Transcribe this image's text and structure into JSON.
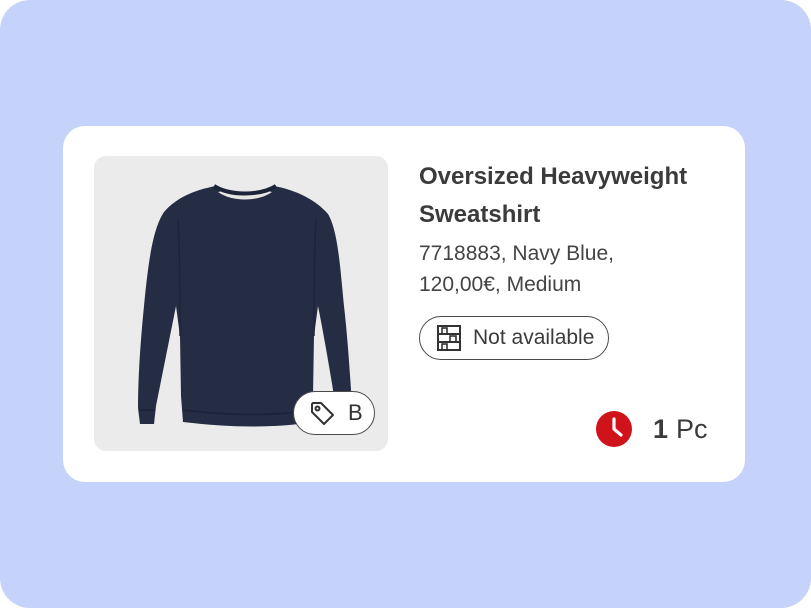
{
  "product": {
    "title": "Oversized Heavyweight Sweatshirt",
    "details_line1": "7718883, Navy Blue,",
    "details_line2": "120,00€, Medium",
    "image_icon": "navy-sweatshirt",
    "tag": {
      "icon": "price-tag-icon",
      "label": "B"
    },
    "availability": {
      "icon": "shelf-icon",
      "label": "Not available"
    },
    "quantity": {
      "icon": "clock-icon",
      "number": "1",
      "unit": "Pc"
    }
  },
  "colors": {
    "background": "#c5d3fa",
    "card": "#ffffff",
    "image_bg": "#ebebeb",
    "sweater": "#252d45",
    "clock_accent": "#d0121b",
    "text": "#3b3b3b"
  }
}
